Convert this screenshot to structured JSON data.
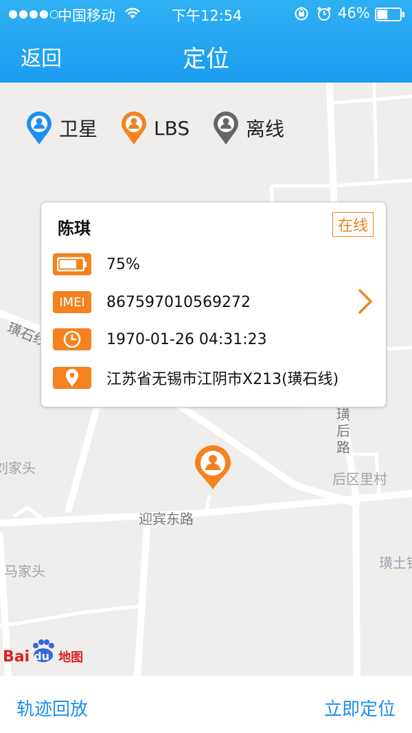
{
  "status_bar": {
    "signal": "●●●●○",
    "carrier": "中国移动",
    "time": "下午12:54",
    "battery_percent": "46%",
    "battery_level": 0.46
  },
  "nav": {
    "back_label": "返回",
    "title": "定位"
  },
  "legend": [
    {
      "label": "卫星",
      "color": "#1e8ef0"
    },
    {
      "label": "LBS",
      "color": "#f4821f"
    },
    {
      "label": "离线",
      "color": "#666666"
    }
  ],
  "info": {
    "name": "陈琪",
    "status": "在线",
    "battery": "75%",
    "battery_level": 0.75,
    "imei_tag": "IMEI",
    "imei": "867597010569272",
    "time": "1970-01-26 04:31:23",
    "address": "江苏省无锡市江阴市X213(璜石线)"
  },
  "map_labels": {
    "road1": "璜石线",
    "road2": "迎宾东路",
    "road3": "璜后路",
    "village1": "后区里村",
    "village2": "马家头",
    "village3": "刘家头",
    "village4": "璜土镇"
  },
  "logo": {
    "bai": "Bai",
    "du": "du",
    "suffix": "地图"
  },
  "bottom": {
    "left_label": "轨迹回放",
    "right_label": "立即定位"
  },
  "colors": {
    "accent": "#f4821f",
    "primary": "#1a8ef0"
  }
}
